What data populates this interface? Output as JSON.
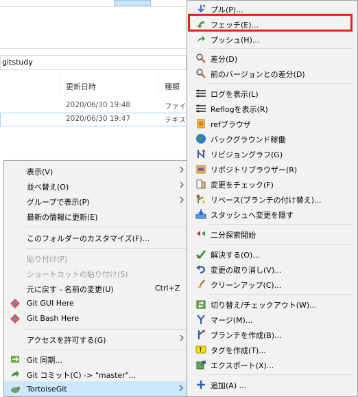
{
  "explorer": {
    "address_text": "gitstudy",
    "columns": [
      "更新日時",
      "種類"
    ],
    "rows": [
      {
        "modified": "2020/06/30 19:48",
        "type": "ファイル"
      },
      {
        "modified": "2020/06/30 19:47",
        "type": "テキスト"
      }
    ]
  },
  "context_menu": {
    "items": [
      {
        "label": "表示(V)",
        "arrow": ">"
      },
      {
        "label": "並べ替え(O)",
        "arrow": ">"
      },
      {
        "label": "グループで表示(P)",
        "arrow": ">"
      },
      {
        "label": "最新の情報に更新(E)"
      },
      {
        "label": "このフォルダーのカスタマイズ(F)..."
      },
      {
        "label": "貼り付け(P)"
      },
      {
        "label": "ショートカットの貼り付け(S)"
      },
      {
        "label": "元に戻す - 名前の変更(U)",
        "shortcut": "Ctrl+Z"
      },
      {
        "label": "Git GUI Here"
      },
      {
        "label": "Git Bash Here"
      },
      {
        "label": "アクセスを許可する(G)",
        "arrow": ">"
      },
      {
        "label": "Git 同期..."
      },
      {
        "label": "Git コミット(C) -> \"master\"..."
      },
      {
        "label": "TortoiseGit",
        "arrow": ">"
      }
    ]
  },
  "tortoisegit_menu": {
    "items": [
      {
        "label": "プル(P)..."
      },
      {
        "label": "フェッチ(E)..."
      },
      {
        "label": "プッシュ(H)..."
      },
      {
        "label": "差分(D)"
      },
      {
        "label": "前のバージョンとの差分(D)"
      },
      {
        "label": "ログを表示(L)"
      },
      {
        "label": "Reflogを表示(R)"
      },
      {
        "label": "refブラウザ"
      },
      {
        "label": "バックグラウンド稼働"
      },
      {
        "label": "リビジョングラフ(G)"
      },
      {
        "label": "リポジトリブラウザー(R)"
      },
      {
        "label": "変更をチェック(F)"
      },
      {
        "label": "リベース(ブランチの付け替え)..."
      },
      {
        "label": "スタッシュへ変更を隠す"
      },
      {
        "label": "二分探索開始"
      },
      {
        "label": "解決する(O)..."
      },
      {
        "label": "変更の取り消し(V)..."
      },
      {
        "label": "クリーンアップ(C)..."
      },
      {
        "label": "切り替え/チェックアウト(W)..."
      },
      {
        "label": "マージ(M)..."
      },
      {
        "label": "ブランチを作成(B)..."
      },
      {
        "label": "タグを作成(T)..."
      },
      {
        "label": "エクスポート(X)..."
      },
      {
        "label": "追加(A) ..."
      }
    ]
  },
  "colors": {
    "highlight_box": "#e8201d",
    "hover_bg": "#cce8ff",
    "menu_bg": "#f2f2f2"
  }
}
